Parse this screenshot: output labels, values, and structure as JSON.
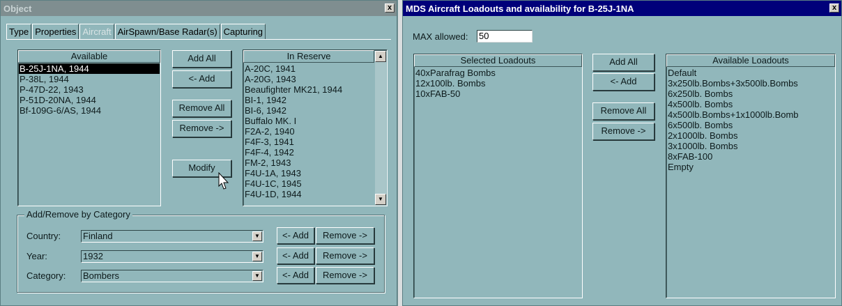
{
  "object_window": {
    "title": "Object",
    "close_glyph": "x",
    "tabs": [
      {
        "label": "Type"
      },
      {
        "label": "Properties"
      },
      {
        "label": "Aircraft"
      },
      {
        "label": "AirSpawn/Base Radar(s)"
      },
      {
        "label": "Capturing"
      }
    ],
    "active_tab": "Aircraft",
    "available": {
      "header": "Available",
      "items": [
        "B-25J-1NA, 1944",
        "P-38L, 1944",
        "P-47D-22, 1943",
        "P-51D-20NA, 1944",
        "Bf-109G-6/AS, 1944"
      ],
      "selected": "B-25J-1NA, 1944"
    },
    "buttons": {
      "add_all": "Add All",
      "add": "<- Add",
      "remove_all": "Remove All",
      "remove": "Remove ->",
      "modify": "Modify"
    },
    "in_reserve": {
      "header": "In Reserve",
      "items": [
        "A-20C, 1941",
        "A-20G, 1943",
        "Beaufighter MK21, 1944",
        "BI-1, 1942",
        "BI-6, 1942",
        "Buffalo MK. I",
        "F2A-2, 1940",
        "F4F-3, 1941",
        "F4F-4, 1942",
        "FM-2, 1943",
        "F4U-1A, 1943",
        "F4U-1C, 1945",
        "F4U-1D, 1944"
      ]
    },
    "category_group": {
      "title": "Add/Remove by Category",
      "rows": [
        {
          "label": "Country:",
          "value": "Finland",
          "add": "<- Add",
          "remove": "Remove ->"
        },
        {
          "label": "Year:",
          "value": "1932",
          "add": "<- Add",
          "remove": "Remove ->"
        },
        {
          "label": "Category:",
          "value": "Bombers",
          "add": "<- Add",
          "remove": "Remove ->"
        }
      ]
    }
  },
  "loadout_window": {
    "title": "MDS Aircraft Loadouts and availability for B-25J-1NA",
    "close_glyph": "x",
    "max_label": "MAX allowed:",
    "max_value": "50",
    "selected": {
      "header": "Selected Loadouts",
      "items": [
        "40xParafrag Bombs",
        "12x100lb. Bombs",
        "10xFAB-50"
      ]
    },
    "buttons": {
      "add_all": "Add All",
      "add": "<- Add",
      "remove_all": "Remove All",
      "remove": "Remove ->"
    },
    "available": {
      "header": "Available Loadouts",
      "items": [
        "Default",
        "3x250lb.Bombs+3x500lb.Bombs",
        "6x250lb. Bombs",
        "4x500lb. Bombs",
        "4x500lb.Bombs+1x1000lb.Bomb",
        "6x500lb. Bombs",
        "2x1000lb. Bombs",
        "3x1000lb. Bombs",
        "8xFAB-100",
        "Empty"
      ]
    }
  },
  "icons": {
    "scroll_up": "scroll-up-arrow-icon",
    "scroll_down": "scroll-down-arrow-icon",
    "dropdown": "dropdown-arrow-icon",
    "cursor": "mouse-cursor-icon"
  },
  "glyphs": {
    "up": "▲",
    "down": "▼"
  }
}
